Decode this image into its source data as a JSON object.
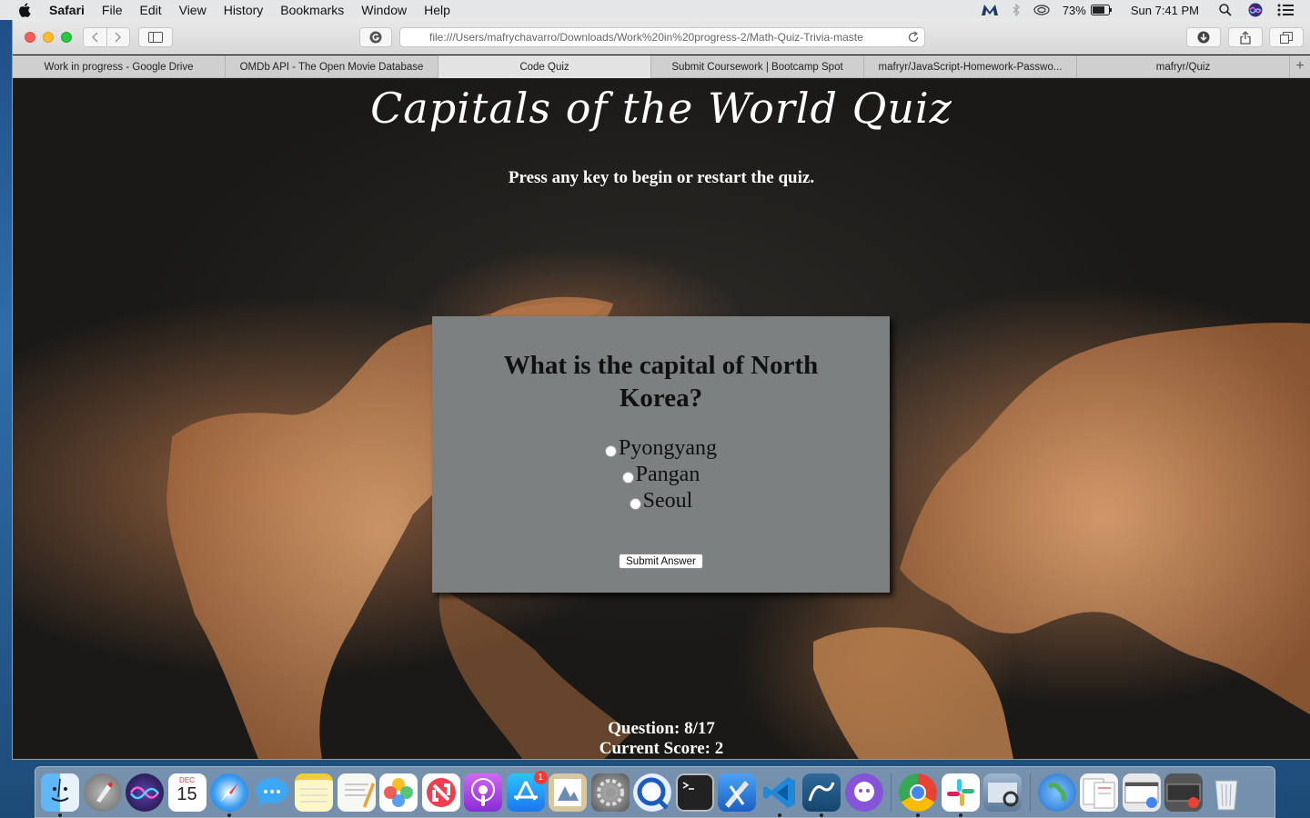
{
  "menubar": {
    "app_name": "Safari",
    "items": [
      "File",
      "Edit",
      "View",
      "History",
      "Bookmarks",
      "Window",
      "Help"
    ],
    "battery": "73%",
    "clock": "Sun 7:41 PM"
  },
  "browser": {
    "url": "file:///Users/mafrychavarro/Downloads/Work%20in%20progress-2/Math-Quiz-Trivia-maste",
    "tabs": [
      {
        "label": "Work in progress - Google Drive",
        "active": false
      },
      {
        "label": "OMDb API - The Open Movie Database",
        "active": false
      },
      {
        "label": "Code Quiz",
        "active": true
      },
      {
        "label": "Submit Coursework | Bootcamp Spot",
        "active": false
      },
      {
        "label": "mafryr/JavaScript-Homework-Passwo...",
        "active": false
      },
      {
        "label": "mafryr/Quiz",
        "active": false
      }
    ],
    "new_tab": "+"
  },
  "page": {
    "title": "Capitals of the World Quiz",
    "instructions": "Press any key to begin or restart the quiz.",
    "question": "What is the capital of North Korea?",
    "answers": [
      "Pyongyang",
      "Pangan",
      "Seoul"
    ],
    "submit_label": "Submit Answer",
    "question_progress": "Question: 8/17",
    "current_score": "Current Score: 2"
  },
  "dock": {
    "apps": [
      "Finder",
      "Launchpad",
      "Siri",
      "Calendar",
      "Safari",
      "Messages",
      "Notes",
      "TextEdit",
      "Photos",
      "News",
      "Podcasts",
      "App Store",
      "Preview",
      "System Preferences",
      "QuickTime Player",
      "Terminal",
      "Xcode",
      "Visual Studio Code",
      "MySQL Workbench",
      "GitHub Desktop",
      "Google Chrome",
      "Slack",
      "Image Capture"
    ],
    "calendar_month": "DEC",
    "calendar_day": "15",
    "app_store_badge": "1"
  },
  "colors": {
    "card_bg": "#7c8080",
    "page_text": "#ffffff"
  }
}
